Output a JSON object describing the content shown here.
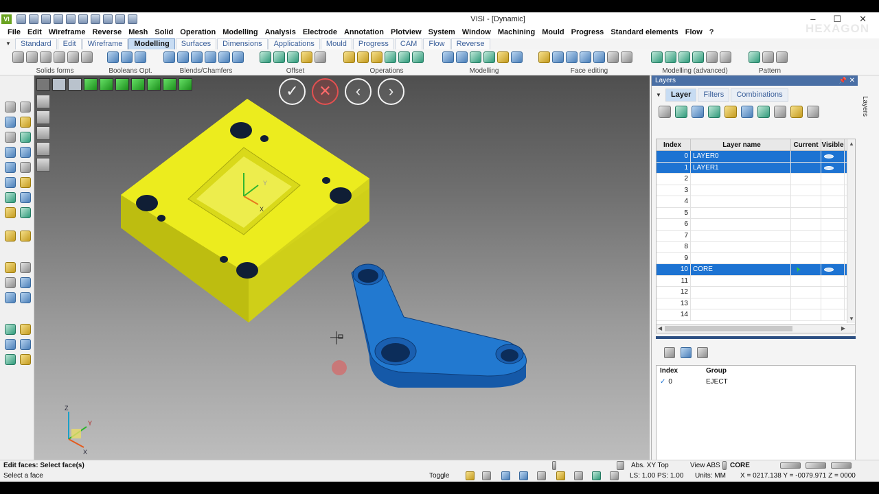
{
  "window": {
    "app_icon": "VI",
    "title": "VISI - [Dynamic]",
    "brand": "HEXAGON",
    "controls": [
      "–",
      "☐",
      "✕"
    ]
  },
  "menu": [
    "File",
    "Edit",
    "Wireframe",
    "Reverse",
    "Mesh",
    "Solid",
    "Operation",
    "Modelling",
    "Analysis",
    "Electrode",
    "Annotation",
    "Plotview",
    "System",
    "Window",
    "Machining",
    "Mould",
    "Progress",
    "Standard elements",
    "Flow",
    "?"
  ],
  "tabs": [
    {
      "label": "Standard",
      "active": false
    },
    {
      "label": "Edit",
      "active": false
    },
    {
      "label": "Wireframe",
      "active": false
    },
    {
      "label": "Modelling",
      "active": true
    },
    {
      "label": "Surfaces",
      "active": false
    },
    {
      "label": "Dimensions",
      "active": false
    },
    {
      "label": "Applications",
      "active": false
    },
    {
      "label": "Mould",
      "active": false
    },
    {
      "label": "Progress",
      "active": false
    },
    {
      "label": "CAM",
      "active": false
    },
    {
      "label": "Flow",
      "active": false
    },
    {
      "label": "Reverse",
      "active": false
    }
  ],
  "ribbon_groups": [
    "Solids forms",
    "Booleans Opt.",
    "Blends/Chamfers",
    "Offset",
    "Operations",
    "Modelling",
    "Face editing",
    "Modelling (advanced)",
    "Pattern"
  ],
  "viewport": {
    "nav_buttons": {
      "confirm": "✓",
      "cancel": "✕",
      "prev": "‹",
      "next": "›"
    },
    "triad": {
      "x": "X",
      "y": "Y",
      "z": "Z"
    },
    "model_axis": {
      "x": "X",
      "y": "Y"
    }
  },
  "panel": {
    "title": "Layers",
    "pin": "📌",
    "close": "✕",
    "side_tab": "Layers",
    "tabs": [
      {
        "label": "Layer",
        "active": true
      },
      {
        "label": "Filters",
        "active": false
      },
      {
        "label": "Combinations",
        "active": false
      }
    ],
    "layer_table": {
      "headers": {
        "index": "Index",
        "name": "Layer name",
        "current": "Current",
        "visible": "Visible"
      },
      "rows": [
        {
          "index": "0",
          "name": "LAYER0",
          "selected": true,
          "current": false,
          "visible": true
        },
        {
          "index": "1",
          "name": "LAYER1",
          "selected": true,
          "current": false,
          "visible": true
        },
        {
          "index": "2",
          "name": "",
          "selected": false,
          "current": false,
          "visible": false
        },
        {
          "index": "3",
          "name": "",
          "selected": false,
          "current": false,
          "visible": false
        },
        {
          "index": "4",
          "name": "",
          "selected": false,
          "current": false,
          "visible": false
        },
        {
          "index": "5",
          "name": "",
          "selected": false,
          "current": false,
          "visible": false
        },
        {
          "index": "6",
          "name": "",
          "selected": false,
          "current": false,
          "visible": false
        },
        {
          "index": "7",
          "name": "",
          "selected": false,
          "current": false,
          "visible": false
        },
        {
          "index": "8",
          "name": "",
          "selected": false,
          "current": false,
          "visible": false
        },
        {
          "index": "9",
          "name": "",
          "selected": false,
          "current": false,
          "visible": false
        },
        {
          "index": "10",
          "name": "CORE",
          "selected": true,
          "current": true,
          "visible": true
        },
        {
          "index": "11",
          "name": "",
          "selected": false,
          "current": false,
          "visible": false
        },
        {
          "index": "12",
          "name": "",
          "selected": false,
          "current": false,
          "visible": false
        },
        {
          "index": "13",
          "name": "",
          "selected": false,
          "current": false,
          "visible": false
        },
        {
          "index": "14",
          "name": "",
          "selected": false,
          "current": false,
          "visible": false
        }
      ]
    },
    "group_table": {
      "headers": {
        "index": "Index",
        "group": "Group"
      },
      "rows": [
        {
          "check": "✓",
          "index": "0",
          "group": "EJECT"
        }
      ]
    }
  },
  "status": {
    "prompt_title": "Edit faces: Select face(s)",
    "prompt_sub": "Select a face",
    "view_name": "Abs. XY Top",
    "view_abs": "View ABS",
    "layer": "CORE",
    "toggle": "Toggle",
    "ls_ps": "LS: 1.00 PS: 1.00",
    "units": "Units: MM",
    "coords": "X = 0217.138 Y = -0079.971 Z = 0000"
  },
  "colors": {
    "accent_blue": "#1d73d2",
    "part_yellow": "#e6e619",
    "part_blue": "#1f6fc2",
    "panel_header": "#4a6fa5"
  }
}
